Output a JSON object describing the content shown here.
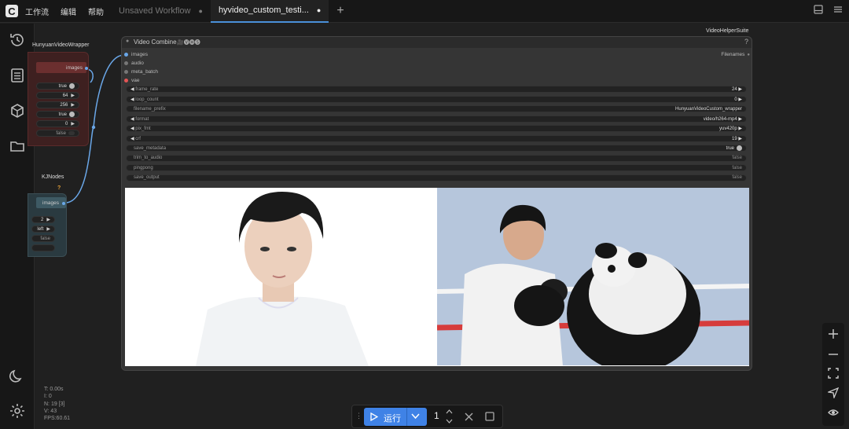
{
  "menu": {
    "items": [
      "工作流",
      "编辑",
      "帮助"
    ]
  },
  "tabs": [
    {
      "label": "Unsaved Workflow",
      "dot": "●"
    },
    {
      "label": "hyvideo_custom_testi...",
      "dot": "●"
    }
  ],
  "left_node_a": {
    "title": "HunyuanVideoWrapper",
    "output": "images",
    "values": [
      "true",
      "64",
      "256",
      "true",
      "0",
      "false"
    ]
  },
  "left_node_b": {
    "title": "KJNodes",
    "badge": "?",
    "output": "images",
    "values": [
      "2",
      "left",
      "false"
    ]
  },
  "video_node": {
    "title": "Video Combine",
    "title_suffix": "🎥🅥🅗🅢",
    "pack": "VideoHelperSuite",
    "help": "?",
    "inputs": [
      "images",
      "audio",
      "meta_batch",
      "vae"
    ],
    "output": "Filenames",
    "widgets": [
      {
        "label": "frame_rate",
        "value": "24",
        "kind": "num"
      },
      {
        "label": "loop_count",
        "value": "0",
        "kind": "num"
      },
      {
        "label": "filename_prefix",
        "value": "HunyuanVideoCustom_wrapper",
        "kind": "text"
      },
      {
        "label": "format",
        "value": "video/h264-mp4",
        "kind": "num"
      },
      {
        "label": "pix_fmt",
        "value": "yuv420p",
        "kind": "num"
      },
      {
        "label": "crf",
        "value": "19",
        "kind": "num"
      },
      {
        "label": "save_metadata",
        "value": "true",
        "kind": "toggle"
      },
      {
        "label": "trim_to_audio",
        "value": "false",
        "kind": "toggle"
      },
      {
        "label": "pingpong",
        "value": "false",
        "kind": "toggle"
      },
      {
        "label": "save_output",
        "value": "false",
        "kind": "toggle"
      }
    ]
  },
  "stats": {
    "t": "T: 0.00s",
    "i": "I: 0",
    "n": "N: 19 [3]",
    "v": "V: 43",
    "fps": "FPS:60.61"
  },
  "runbar": {
    "run_label": "运行",
    "count": "1"
  },
  "colors": {
    "accent": "#4a90d9",
    "run_button": "#3f82e6",
    "node_red": "#5a2626",
    "node_teal": "#2a3a40"
  }
}
